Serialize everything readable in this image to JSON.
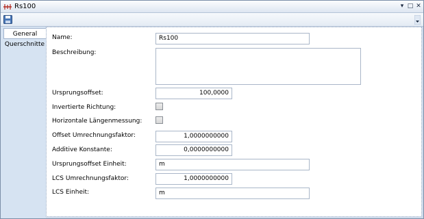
{
  "window": {
    "title": "Rs100",
    "controls": {
      "minimize": "▾",
      "maximize": "□",
      "close": "✕"
    }
  },
  "toolbar": {
    "save_icon": "save-icon",
    "overflow_icon": "chevron-down-icon"
  },
  "sidebar": {
    "tabs": [
      {
        "label": "General",
        "active": true
      },
      {
        "label": "Querschnitte",
        "active": false
      }
    ]
  },
  "form": {
    "name": {
      "label": "Name:",
      "value": "Rs100"
    },
    "description": {
      "label": "Beschreibung:",
      "value": ""
    },
    "origin_offset": {
      "label": "Ursprungsoffset:",
      "value": "100,0000"
    },
    "inverted_direction": {
      "label": "Invertierte Richtung:",
      "checked": false
    },
    "horizontal_length": {
      "label": "Horizontale Längenmessung:",
      "checked": false
    },
    "offset_factor": {
      "label": "Offset Umrechnungsfaktor:",
      "value": "1,0000000000"
    },
    "additive_constant": {
      "label": "Additive Konstante:",
      "value": "0,0000000000"
    },
    "origin_offset_unit": {
      "label": "Ursprungsoffset Einheit:",
      "value": "m"
    },
    "lcs_factor": {
      "label": "LCS Umrechnungsfaktor:",
      "value": "1,0000000000"
    },
    "lcs_unit": {
      "label": "LCS Einheit:",
      "value": "m"
    }
  }
}
